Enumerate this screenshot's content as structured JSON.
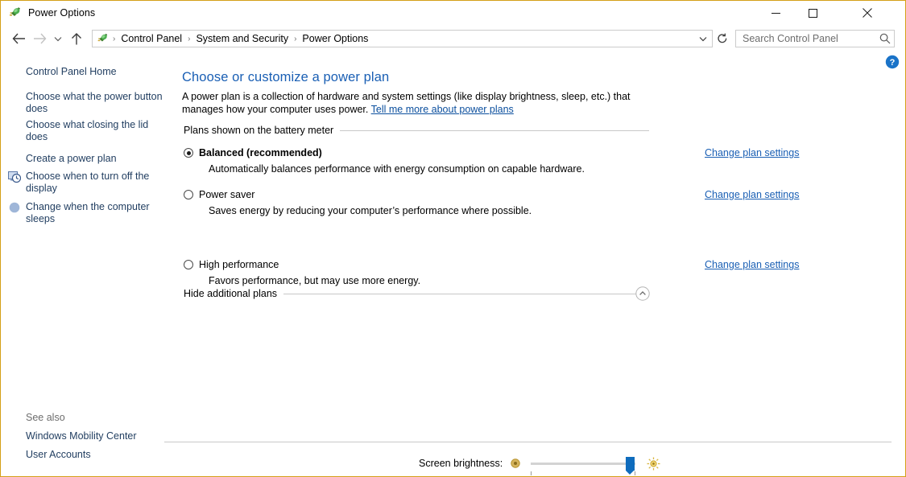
{
  "window": {
    "title": "Power Options",
    "icon": "power-plug-icon",
    "border_color": "#d4a017",
    "controls": {
      "minimize": "minimize-icon",
      "maximize": "maximize-icon",
      "close": "close-icon"
    }
  },
  "toolbar": {
    "back": "back-arrow-icon",
    "forward": "forward-arrow-icon",
    "recent": "recent-pages-chevron-icon",
    "up": "up-arrow-icon",
    "address_icon": "power-plug-icon",
    "breadcrumbs": [
      "Control Panel",
      "System and Security",
      "Power Options"
    ],
    "separator": "›",
    "dropdown": "chevron-down-icon",
    "refresh": "refresh-icon",
    "search": {
      "placeholder": "Search Control Panel",
      "value": "",
      "icon": "search-icon"
    }
  },
  "help": {
    "icon": "help-question-icon",
    "color": "#1a73c8"
  },
  "sidebar": {
    "items": [
      {
        "label": "Control Panel Home",
        "icon": null
      },
      {
        "label": "Choose what the power button does",
        "icon": null
      },
      {
        "label": "Choose what closing the lid does",
        "icon": null
      },
      {
        "label": "Create a power plan",
        "icon": null
      },
      {
        "label": "Choose when to turn off the display",
        "icon": "display-clock-icon"
      },
      {
        "label": "Change when the computer sleeps",
        "icon": "moon-sleep-icon"
      }
    ],
    "see_also_label": "See also",
    "see_also_items": [
      {
        "label": "Windows Mobility Center"
      },
      {
        "label": "User Accounts"
      }
    ]
  },
  "main": {
    "title": "Choose or customize a power plan",
    "description_before": "A power plan is a collection of hardware and system settings (like display brightness, sleep, etc.) that manages how your computer uses power. ",
    "description_link": "Tell me more about power plans",
    "groups": [
      {
        "heading": "Plans shown on the battery meter",
        "collapse_icon": null,
        "plans": [
          {
            "name": "Balanced (recommended)",
            "selected": true,
            "bold": true,
            "description": "Automatically balances performance with energy consumption on capable hardware.",
            "link": "Change plan settings"
          },
          {
            "name": "Power saver",
            "selected": false,
            "bold": false,
            "description": "Saves energy by reducing your computer’s performance where possible.",
            "link": "Change plan settings"
          }
        ]
      },
      {
        "heading": "Hide additional plans",
        "collapse_icon": "chevron-up-circle-icon",
        "plans": [
          {
            "name": "High performance",
            "selected": false,
            "bold": false,
            "description": "Favors performance, but may use more energy.",
            "link": "Change plan settings"
          }
        ]
      }
    ]
  },
  "brightness": {
    "label": "Screen brightness:",
    "dim_icon": "sun-dim-icon",
    "bright_icon": "sun-bright-icon",
    "value_percent": 95,
    "thumb_color": "#0f6cbd"
  }
}
